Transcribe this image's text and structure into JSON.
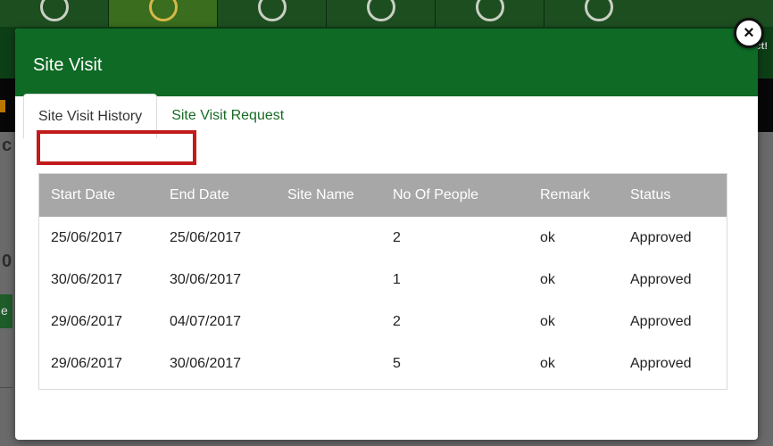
{
  "modal": {
    "title": "Site Visit",
    "close_icon": "close-icon",
    "close_label": "×"
  },
  "tabs": [
    {
      "label": "Site Visit History",
      "active": true
    },
    {
      "label": "Site Visit Request",
      "active": false
    }
  ],
  "table": {
    "columns": [
      "Start Date",
      "End Date",
      "Site Name",
      "No Of People",
      "Remark",
      "Status"
    ],
    "rows": [
      [
        "25/06/2017",
        "25/06/2017",
        "",
        "2",
        "ok",
        "Approved"
      ],
      [
        "30/06/2017",
        "30/06/2017",
        "",
        "1",
        "ok",
        "Approved"
      ],
      [
        "29/06/2017",
        "04/07/2017",
        "",
        "2",
        "ok",
        "Approved"
      ],
      [
        "29/06/2017",
        "30/06/2017",
        "",
        "5",
        "ok",
        "Approved"
      ]
    ]
  },
  "background": {
    "nav_icons": [
      "target-icon",
      "alert-icon",
      "card-icon",
      "info-icon",
      "help-icon",
      "key-icon"
    ],
    "partial_text_1": "c",
    "partial_text_2": "0",
    "partial_text_3": "e",
    "right_badge": "ct!"
  },
  "colors": {
    "header_green": "#0e6a24",
    "highlight_red": "#c21a1a",
    "table_header_gray": "#a7a7a7",
    "link_green": "#176b24"
  }
}
